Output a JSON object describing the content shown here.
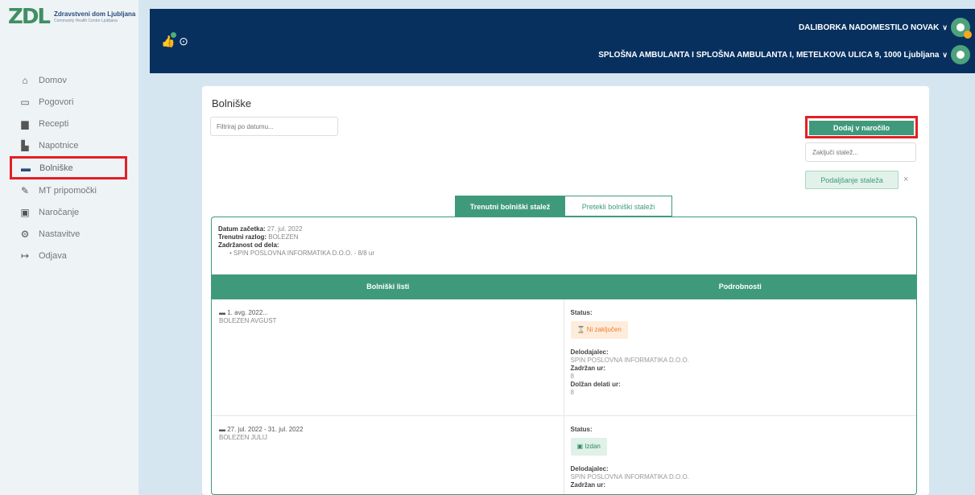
{
  "logo": {
    "mark": "ZDL",
    "title": "Zdravstveni dom Ljubljana",
    "subtitle": "Community Health Centre Ljubljana"
  },
  "sidebar": {
    "items": [
      {
        "label": "Domov",
        "icon": "home-icon"
      },
      {
        "label": "Pogovori",
        "icon": "chat-icon"
      },
      {
        "label": "Recepti",
        "icon": "prescription-icon"
      },
      {
        "label": "Napotnice",
        "icon": "referral-icon"
      },
      {
        "label": "Bolniške",
        "icon": "bed-icon"
      },
      {
        "label": "MT pripomočki",
        "icon": "tool-icon"
      },
      {
        "label": "Naročanje",
        "icon": "calendar-icon"
      },
      {
        "label": "Nastavitve",
        "icon": "gear-icon"
      },
      {
        "label": "Odjava",
        "icon": "logout-icon"
      }
    ]
  },
  "header": {
    "user_name": "DALIBORKA NADOMESTILO NOVAK",
    "clinic": "SPLOŠNA AMBULANTA I SPLOŠNA AMBULANTA I, METELKOVA ULICA 9, 1000 Ljubljana"
  },
  "page": {
    "title": "Bolniške",
    "filter_placeholder": "Filtriraj po datumu...",
    "add_button": "Dodaj v naročilo",
    "close_placeholder": "Zaključi stalež...",
    "extend_button": "Podaljšanje staleža",
    "extend_close": "×"
  },
  "tabs": [
    {
      "label": "Trenutni bolniški stalež"
    },
    {
      "label": "Pretekli bolniški staleži"
    }
  ],
  "summary": {
    "start_label": "Datum začetka:",
    "start_value": "27. jul. 2022",
    "reason_label": "Trenutni razlog:",
    "reason_value": "BOLEZEN",
    "absence_label": "Zadržanost od dela:",
    "employer_entry": "SPIN POSLOVNA INFORMATIKA D.O.O. - 8/8 ur"
  },
  "table": {
    "headers": [
      "Bolniški listi",
      "Podrobnosti"
    ],
    "rows": [
      {
        "date": "1. avg. 2022...",
        "reason": "BOLEZEN AVGUST",
        "status_label": "Status:",
        "status": "Ni zaključen",
        "employer_label": "Delodajalec:",
        "employer": "SPIN POSLOVNA INFORMATIKA D.O.O.",
        "hours_label": "Zadržan ur:",
        "hours": "8",
        "work_label": "Dolžan delati ur:",
        "work": "8"
      },
      {
        "date": "27. jul. 2022 - 31. jul. 2022",
        "reason": "BOLEZEN JULIJ",
        "status_label": "Status:",
        "status": "Izdan",
        "employer_label": "Delodajalec:",
        "employer": "SPIN POSLOVNA INFORMATIKA D.O.O.",
        "hours_label": "Zadržan ur:"
      }
    ]
  }
}
